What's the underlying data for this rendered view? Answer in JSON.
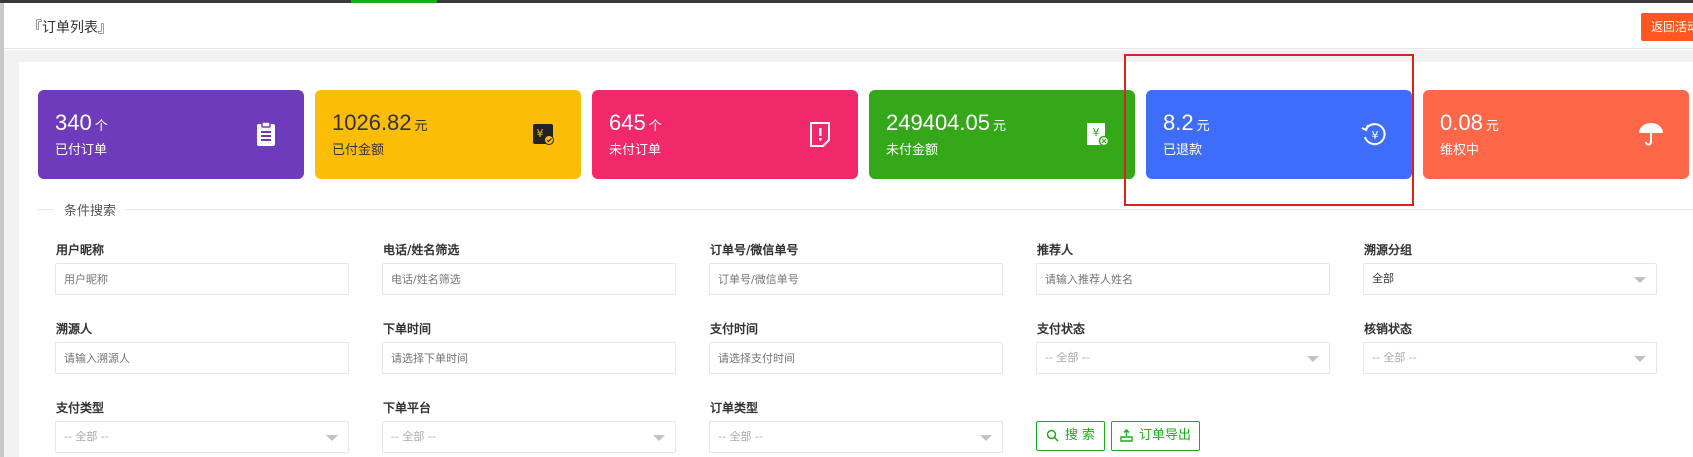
{
  "header": {
    "title": "『订单列表』",
    "back_label": "返回活动"
  },
  "cards": [
    {
      "value": "340",
      "unit": "个",
      "label": "已付订单",
      "color": "#6f3bbd",
      "icon": "clipboard-icon"
    },
    {
      "value": "1026.82",
      "unit": "元",
      "label": "已付金额",
      "color": "#fbbd06",
      "icon": "wallet-yen-icon"
    },
    {
      "value": "645",
      "unit": "个",
      "label": "未付订单",
      "color": "#f1296a",
      "icon": "document-alert-icon"
    },
    {
      "value": "249404.05",
      "unit": "元",
      "label": "未付金额",
      "color": "#35a819",
      "icon": "receipt-yen-icon"
    },
    {
      "value": "8.2",
      "unit": "元",
      "label": "已退款",
      "color": "#3d6dfa",
      "icon": "refund-yen-icon"
    },
    {
      "value": "0.08",
      "unit": "元",
      "label": "维权中",
      "color": "#fe6849",
      "icon": "umbrella-icon"
    }
  ],
  "search": {
    "legend": "条件搜索",
    "fields": [
      {
        "label": "用户昵称",
        "placeholder": "用户昵称"
      },
      {
        "label": "电话/姓名筛选",
        "placeholder": "电话/姓名筛选"
      },
      {
        "label": "订单号/微信单号",
        "placeholder": "订单号/微信单号"
      },
      {
        "label": "推荐人",
        "placeholder": "请输入推荐人姓名"
      },
      {
        "label": "溯源分组",
        "value": "全部"
      },
      {
        "label": "溯源人",
        "placeholder": "请输入溯源人"
      },
      {
        "label": "下单时间",
        "placeholder": "请选择下单时间"
      },
      {
        "label": "支付时间",
        "placeholder": "请选择支付时间"
      },
      {
        "label": "支付状态",
        "value": "-- 全部 --"
      },
      {
        "label": "核销状态",
        "value": "-- 全部 --"
      },
      {
        "label": "支付类型",
        "value": "-- 全部 --"
      },
      {
        "label": "下单平台",
        "value": "-- 全部 --"
      },
      {
        "label": "订单类型",
        "value": "-- 全部 --"
      }
    ],
    "search_button": "搜 索",
    "export_button": "订单导出"
  }
}
